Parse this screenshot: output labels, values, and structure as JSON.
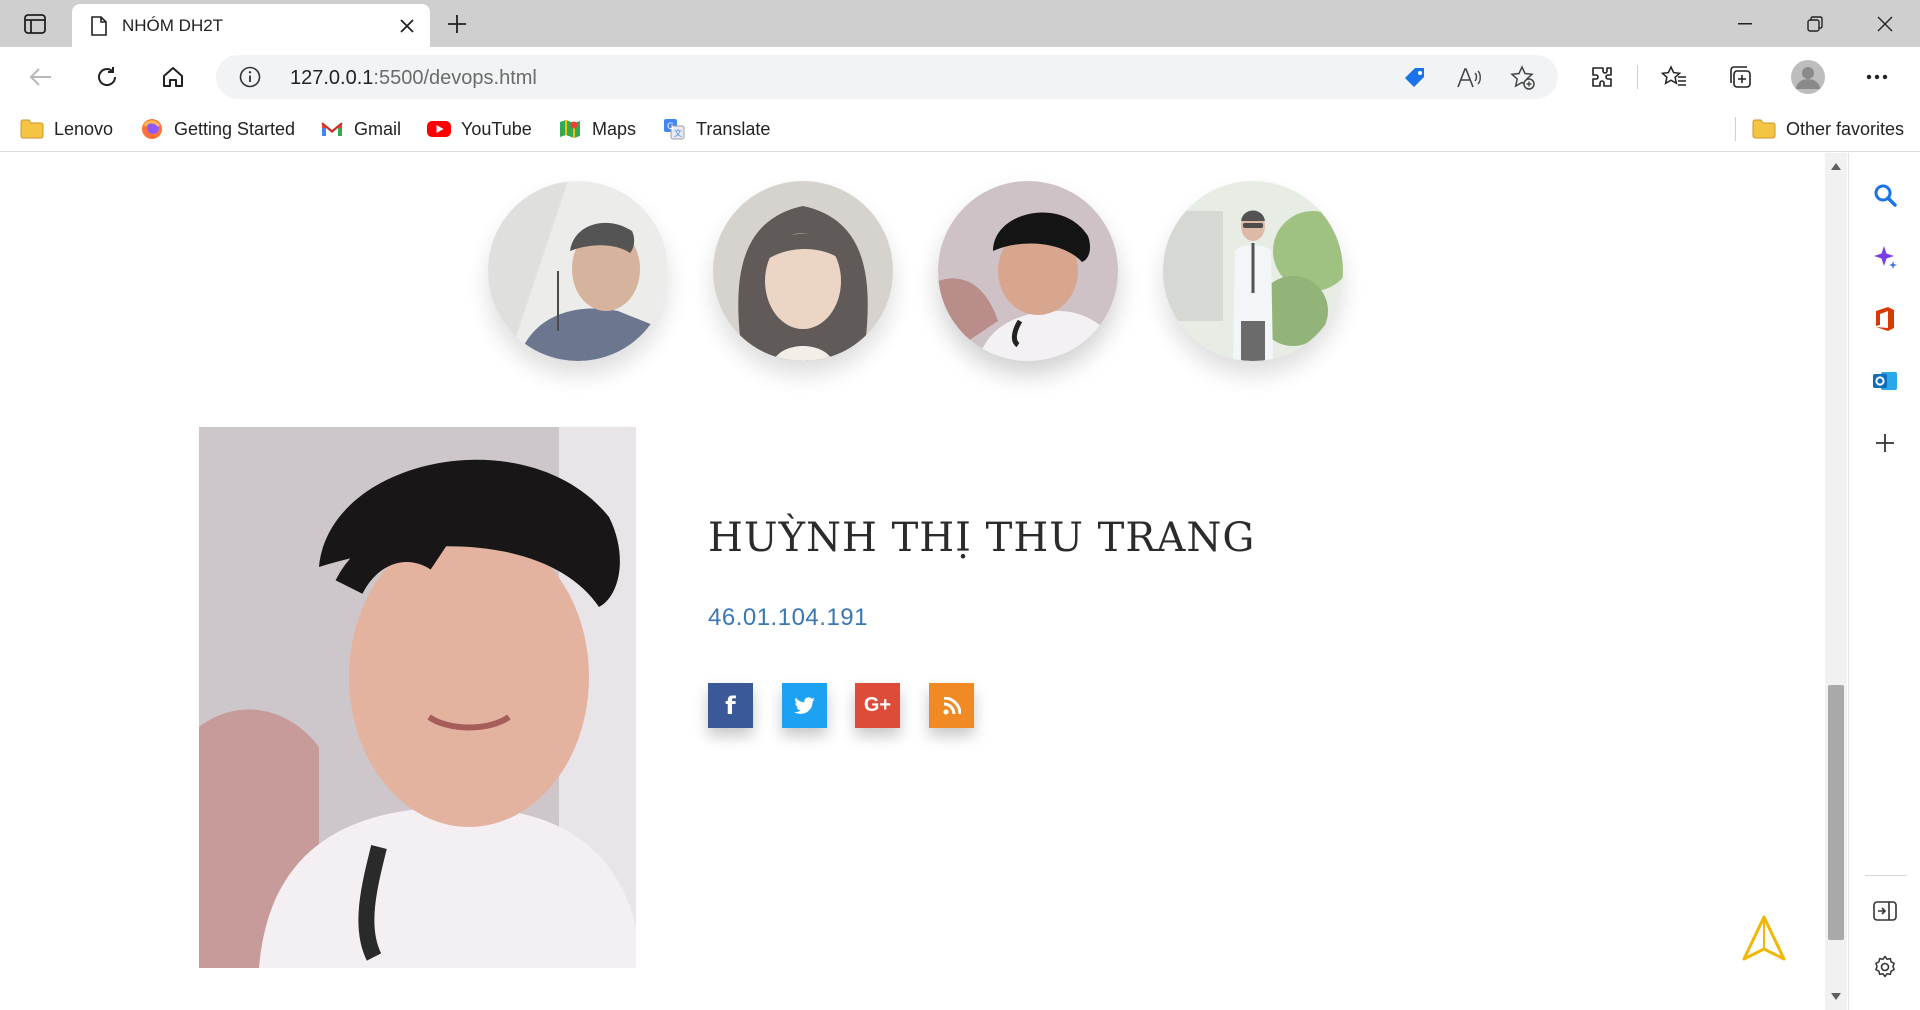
{
  "browser": {
    "tab": {
      "title": "NHÓM DH2T"
    },
    "address": {
      "host": "127.0.0.1",
      "port_path": ":5500/devops.html"
    },
    "favorites": [
      {
        "label": "Lenovo",
        "icon": "folder-icon"
      },
      {
        "label": "Getting Started",
        "icon": "firefox-icon"
      },
      {
        "label": "Gmail",
        "icon": "gmail-icon"
      },
      {
        "label": "YouTube",
        "icon": "youtube-icon"
      },
      {
        "label": "Maps",
        "icon": "maps-icon"
      },
      {
        "label": "Translate",
        "icon": "translate-icon"
      }
    ],
    "other_favorites": "Other favorites"
  },
  "page": {
    "team": [
      {
        "name": "member-1"
      },
      {
        "name": "member-2"
      },
      {
        "name": "member-3"
      },
      {
        "name": "member-4"
      }
    ],
    "profile": {
      "name": "HUỲNH THỊ THU TRANG",
      "student_id": "46.01.104.191"
    },
    "social": {
      "facebook": "f",
      "google": "G+"
    }
  },
  "colors": {
    "accent_link": "#3a76b6",
    "facebook": "#3b5998",
    "twitter": "#1da1f2",
    "google": "#dd4b39",
    "rss": "#f08a24",
    "back_to_top": "#f2b705"
  }
}
